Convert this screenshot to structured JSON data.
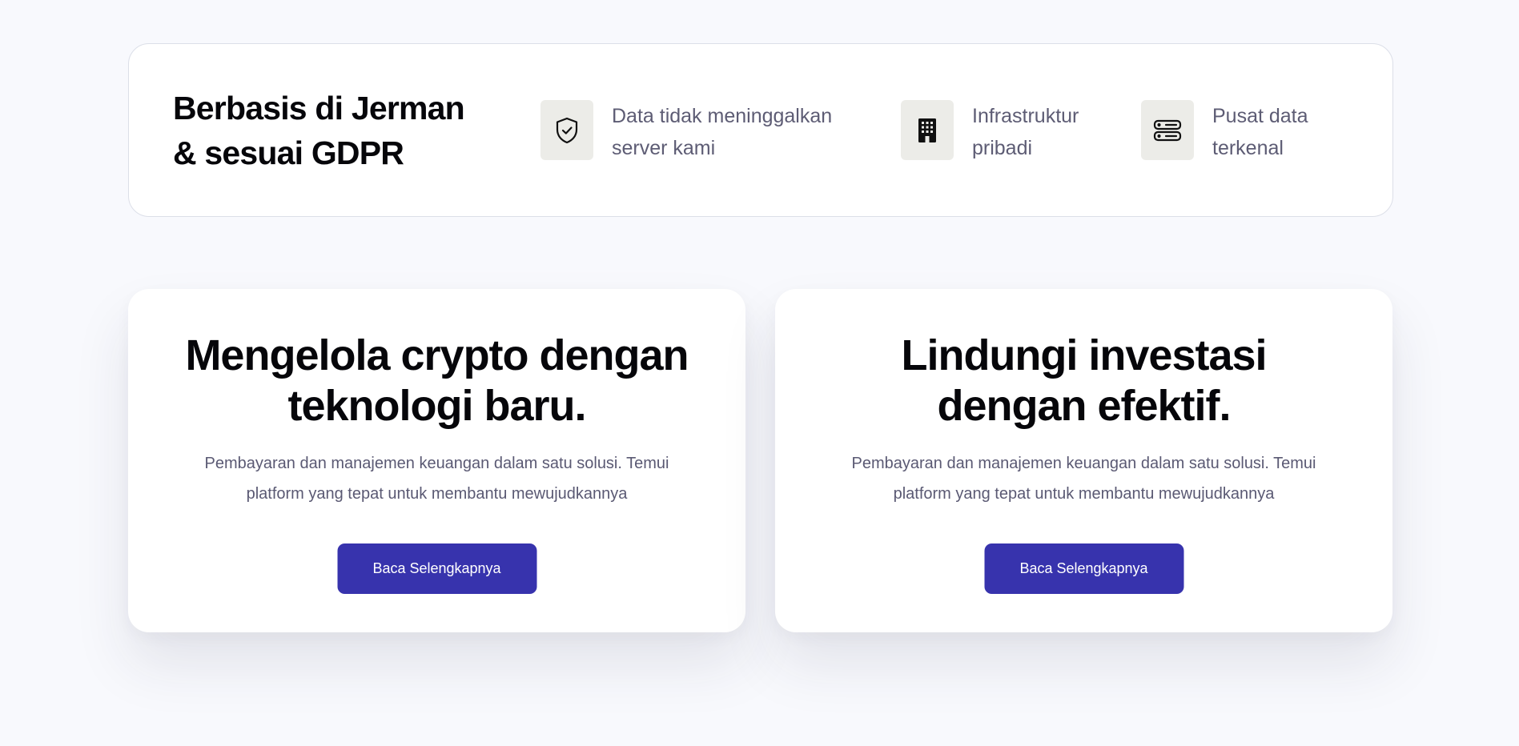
{
  "trust_bar": {
    "title": "Berbasis di Jerman & sesuai GDPR",
    "features": [
      {
        "icon": "shield-check-icon",
        "text": "Data tidak meninggalkan server kami"
      },
      {
        "icon": "building-icon",
        "text": "Infrastruktur pribadi"
      },
      {
        "icon": "server-icon",
        "text": "Pusat data terkenal"
      }
    ]
  },
  "cards": [
    {
      "title": "Mengelola crypto dengan teknologi baru.",
      "description": "Pembayaran dan manajemen keuangan dalam satu solusi. Temui platform yang tepat untuk membantu mewujudkannya",
      "button_label": "Baca Selengkapnya"
    },
    {
      "title": "Lindungi investasi dengan efektif.",
      "description": "Pembayaran dan manajemen keuangan dalam satu solusi. Temui platform yang tepat untuk membantu mewujudkannya",
      "button_label": "Baca Selengkapnya"
    }
  ],
  "colors": {
    "background": "#f8f9fd",
    "button": "#3733ad",
    "icon_box": "#ecece8",
    "body_text": "#5a5973"
  }
}
